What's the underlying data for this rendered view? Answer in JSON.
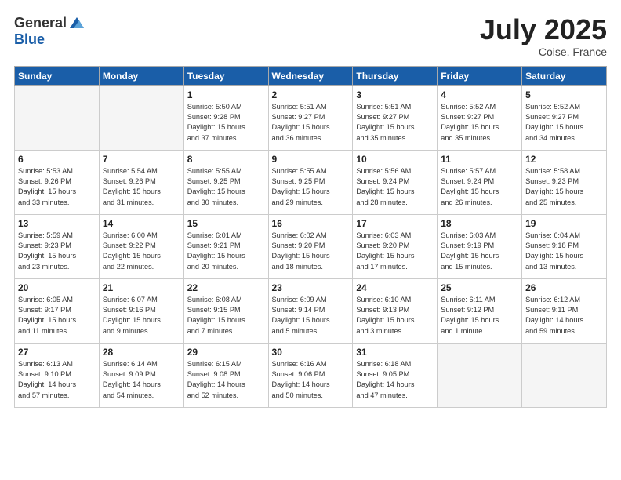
{
  "header": {
    "logo_general": "General",
    "logo_blue": "Blue",
    "month_title": "July 2025",
    "subtitle": "Coise, France"
  },
  "days_of_week": [
    "Sunday",
    "Monday",
    "Tuesday",
    "Wednesday",
    "Thursday",
    "Friday",
    "Saturday"
  ],
  "weeks": [
    [
      {
        "day": "",
        "detail": ""
      },
      {
        "day": "",
        "detail": ""
      },
      {
        "day": "1",
        "detail": "Sunrise: 5:50 AM\nSunset: 9:28 PM\nDaylight: 15 hours\nand 37 minutes."
      },
      {
        "day": "2",
        "detail": "Sunrise: 5:51 AM\nSunset: 9:27 PM\nDaylight: 15 hours\nand 36 minutes."
      },
      {
        "day": "3",
        "detail": "Sunrise: 5:51 AM\nSunset: 9:27 PM\nDaylight: 15 hours\nand 35 minutes."
      },
      {
        "day": "4",
        "detail": "Sunrise: 5:52 AM\nSunset: 9:27 PM\nDaylight: 15 hours\nand 35 minutes."
      },
      {
        "day": "5",
        "detail": "Sunrise: 5:52 AM\nSunset: 9:27 PM\nDaylight: 15 hours\nand 34 minutes."
      }
    ],
    [
      {
        "day": "6",
        "detail": "Sunrise: 5:53 AM\nSunset: 9:26 PM\nDaylight: 15 hours\nand 33 minutes."
      },
      {
        "day": "7",
        "detail": "Sunrise: 5:54 AM\nSunset: 9:26 PM\nDaylight: 15 hours\nand 31 minutes."
      },
      {
        "day": "8",
        "detail": "Sunrise: 5:55 AM\nSunset: 9:25 PM\nDaylight: 15 hours\nand 30 minutes."
      },
      {
        "day": "9",
        "detail": "Sunrise: 5:55 AM\nSunset: 9:25 PM\nDaylight: 15 hours\nand 29 minutes."
      },
      {
        "day": "10",
        "detail": "Sunrise: 5:56 AM\nSunset: 9:24 PM\nDaylight: 15 hours\nand 28 minutes."
      },
      {
        "day": "11",
        "detail": "Sunrise: 5:57 AM\nSunset: 9:24 PM\nDaylight: 15 hours\nand 26 minutes."
      },
      {
        "day": "12",
        "detail": "Sunrise: 5:58 AM\nSunset: 9:23 PM\nDaylight: 15 hours\nand 25 minutes."
      }
    ],
    [
      {
        "day": "13",
        "detail": "Sunrise: 5:59 AM\nSunset: 9:23 PM\nDaylight: 15 hours\nand 23 minutes."
      },
      {
        "day": "14",
        "detail": "Sunrise: 6:00 AM\nSunset: 9:22 PM\nDaylight: 15 hours\nand 22 minutes."
      },
      {
        "day": "15",
        "detail": "Sunrise: 6:01 AM\nSunset: 9:21 PM\nDaylight: 15 hours\nand 20 minutes."
      },
      {
        "day": "16",
        "detail": "Sunrise: 6:02 AM\nSunset: 9:20 PM\nDaylight: 15 hours\nand 18 minutes."
      },
      {
        "day": "17",
        "detail": "Sunrise: 6:03 AM\nSunset: 9:20 PM\nDaylight: 15 hours\nand 17 minutes."
      },
      {
        "day": "18",
        "detail": "Sunrise: 6:03 AM\nSunset: 9:19 PM\nDaylight: 15 hours\nand 15 minutes."
      },
      {
        "day": "19",
        "detail": "Sunrise: 6:04 AM\nSunset: 9:18 PM\nDaylight: 15 hours\nand 13 minutes."
      }
    ],
    [
      {
        "day": "20",
        "detail": "Sunrise: 6:05 AM\nSunset: 9:17 PM\nDaylight: 15 hours\nand 11 minutes."
      },
      {
        "day": "21",
        "detail": "Sunrise: 6:07 AM\nSunset: 9:16 PM\nDaylight: 15 hours\nand 9 minutes."
      },
      {
        "day": "22",
        "detail": "Sunrise: 6:08 AM\nSunset: 9:15 PM\nDaylight: 15 hours\nand 7 minutes."
      },
      {
        "day": "23",
        "detail": "Sunrise: 6:09 AM\nSunset: 9:14 PM\nDaylight: 15 hours\nand 5 minutes."
      },
      {
        "day": "24",
        "detail": "Sunrise: 6:10 AM\nSunset: 9:13 PM\nDaylight: 15 hours\nand 3 minutes."
      },
      {
        "day": "25",
        "detail": "Sunrise: 6:11 AM\nSunset: 9:12 PM\nDaylight: 15 hours\nand 1 minute."
      },
      {
        "day": "26",
        "detail": "Sunrise: 6:12 AM\nSunset: 9:11 PM\nDaylight: 14 hours\nand 59 minutes."
      }
    ],
    [
      {
        "day": "27",
        "detail": "Sunrise: 6:13 AM\nSunset: 9:10 PM\nDaylight: 14 hours\nand 57 minutes."
      },
      {
        "day": "28",
        "detail": "Sunrise: 6:14 AM\nSunset: 9:09 PM\nDaylight: 14 hours\nand 54 minutes."
      },
      {
        "day": "29",
        "detail": "Sunrise: 6:15 AM\nSunset: 9:08 PM\nDaylight: 14 hours\nand 52 minutes."
      },
      {
        "day": "30",
        "detail": "Sunrise: 6:16 AM\nSunset: 9:06 PM\nDaylight: 14 hours\nand 50 minutes."
      },
      {
        "day": "31",
        "detail": "Sunrise: 6:18 AM\nSunset: 9:05 PM\nDaylight: 14 hours\nand 47 minutes."
      },
      {
        "day": "",
        "detail": ""
      },
      {
        "day": "",
        "detail": ""
      }
    ]
  ]
}
